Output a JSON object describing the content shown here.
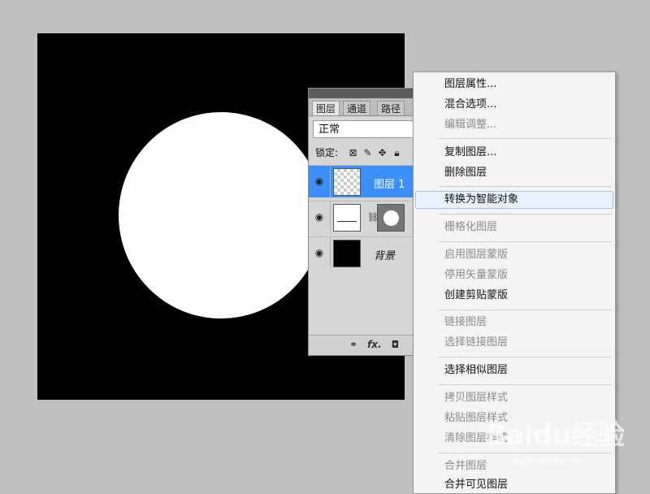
{
  "layers_panel": {
    "tabs": [
      "图层",
      "通道",
      "路径"
    ],
    "blend_mode": "正常",
    "lock_label": "锁定:",
    "lock_icons": [
      "lock-transparency-icon",
      "lock-paint-icon",
      "lock-move-icon",
      "lock-all-icon"
    ],
    "layers": [
      {
        "name": "图层 1",
        "selected": true,
        "thumb": "transparent"
      },
      {
        "name": "",
        "selected": false,
        "thumb": "adjustment-with-mask"
      },
      {
        "name": "背景",
        "selected": false,
        "thumb": "black"
      }
    ],
    "bottom_icons": [
      "link-layers-icon",
      "fx-icon",
      "add-mask-icon"
    ],
    "fx_label": "fx."
  },
  "context_menu": {
    "items": [
      {
        "label": "图层属性...",
        "disabled": false
      },
      {
        "label": "混合选项...",
        "disabled": false
      },
      {
        "label": "编辑调整...",
        "disabled": true
      },
      {
        "label": "复制图层...",
        "disabled": false
      },
      {
        "label": "删除图层",
        "disabled": false
      },
      {
        "label": "转换为智能对象",
        "disabled": false,
        "hover": true
      },
      {
        "label": "栅格化图层",
        "disabled": true
      },
      {
        "label": "启用图层蒙版",
        "disabled": true
      },
      {
        "label": "停用矢量蒙版",
        "disabled": true
      },
      {
        "label": "创建剪贴蒙版",
        "disabled": false
      },
      {
        "label": "链接图层",
        "disabled": true
      },
      {
        "label": "选择链接图层",
        "disabled": true
      },
      {
        "label": "选择相似图层",
        "disabled": false
      },
      {
        "label": "拷贝图层样式",
        "disabled": true
      },
      {
        "label": "粘贴图层样式",
        "disabled": true
      },
      {
        "label": "清除图层样式",
        "disabled": true
      },
      {
        "label": "合并图层",
        "disabled": true
      },
      {
        "label": "合并可见图层",
        "disabled": false
      }
    ]
  },
  "watermark": {
    "brand": "Baidu经验",
    "url": "jingyan.baidu.com"
  },
  "colors": {
    "selection": "#3b8ff5",
    "workspace": "#c0c0c0",
    "menu_bg": "#f4f4f4"
  }
}
